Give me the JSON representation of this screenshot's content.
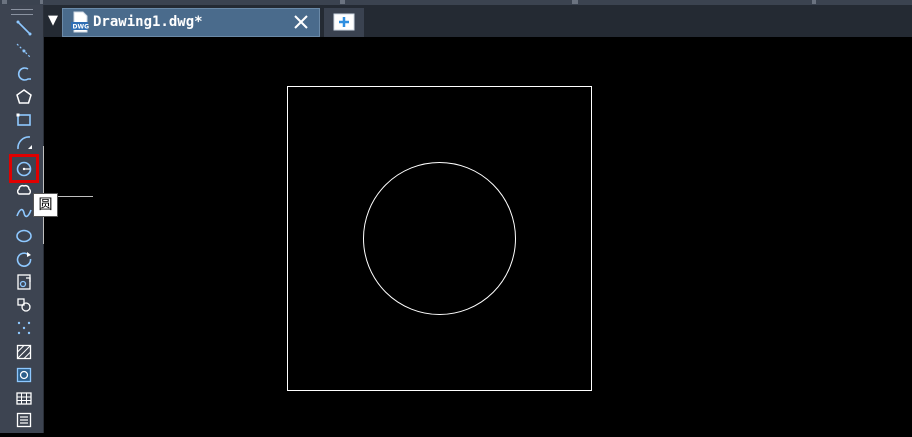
{
  "document_tab": {
    "title": "Drawing1.dwg*"
  },
  "tooltip": {
    "text": "圆"
  },
  "colors": {
    "accent_highlight": "#e00000",
    "tab_active": "#4a6b8c",
    "canvas_bg": "#000000",
    "tool_icon": "#8ec8ff"
  },
  "toolbar": {
    "tools": [
      {
        "name": "line-icon"
      },
      {
        "name": "construction-line-icon"
      },
      {
        "name": "polyline-icon"
      },
      {
        "name": "polygon-icon"
      },
      {
        "name": "rectangle-icon"
      },
      {
        "name": "arc-icon"
      },
      {
        "name": "circle-icon",
        "active": true
      },
      {
        "name": "revision-cloud-icon"
      },
      {
        "name": "spline-icon"
      },
      {
        "name": "ellipse-icon"
      },
      {
        "name": "ellipse-arc-icon"
      },
      {
        "name": "insert-block-icon"
      },
      {
        "name": "make-block-icon"
      },
      {
        "name": "point-icon"
      },
      {
        "name": "hatch-icon"
      },
      {
        "name": "region-icon"
      },
      {
        "name": "table-icon"
      },
      {
        "name": "multiline-text-icon"
      }
    ]
  }
}
